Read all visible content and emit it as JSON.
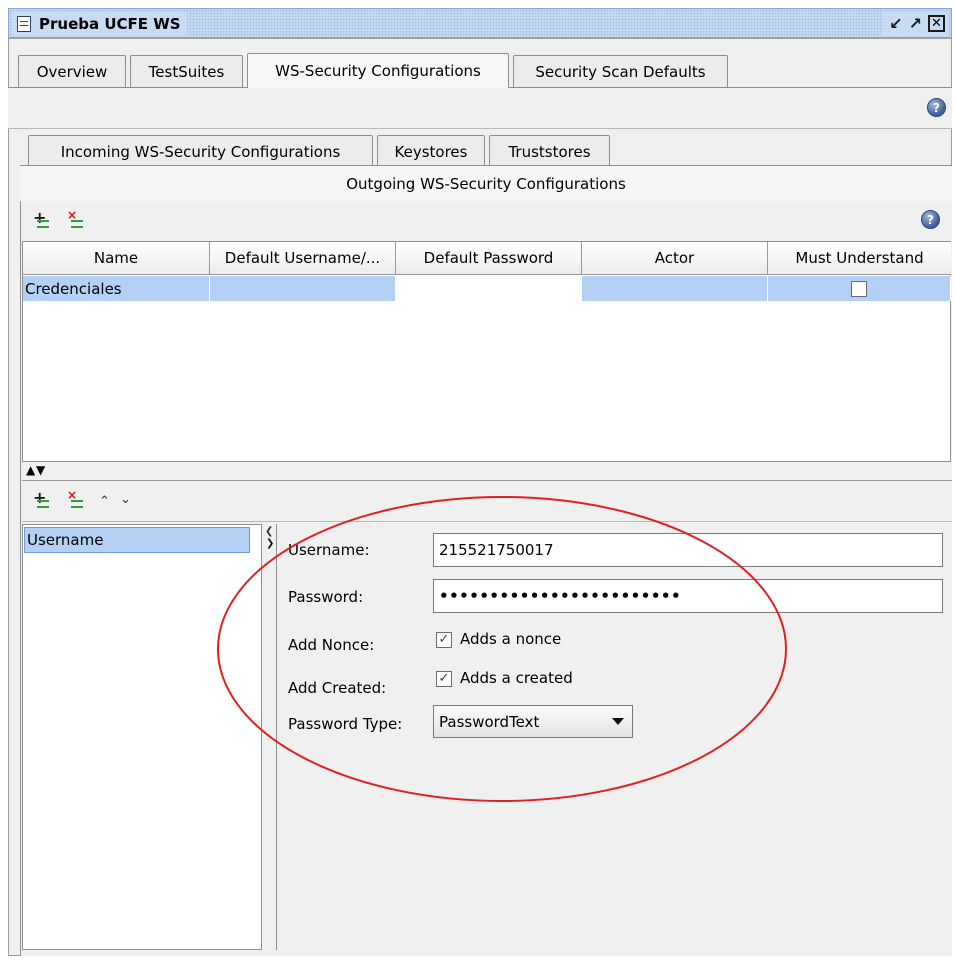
{
  "window": {
    "title": "Prueba UCFE WS",
    "buttons": [
      "restore-icon",
      "maximize-icon",
      "close-icon"
    ]
  },
  "main_tabs": [
    {
      "label": "Overview",
      "active": false
    },
    {
      "label": "TestSuites",
      "active": false
    },
    {
      "label": "WS-Security Configurations",
      "active": true
    },
    {
      "label": "Security Scan Defaults",
      "active": false
    }
  ],
  "sub_tabs": [
    {
      "label": "Incoming WS-Security Configurations",
      "active": false
    },
    {
      "label": "Keystores",
      "active": false
    },
    {
      "label": "Truststores",
      "active": false
    },
    {
      "label": "Outgoing WS-Security Configurations",
      "active": true
    }
  ],
  "help_icon_text": "?",
  "table": {
    "columns": [
      "Name",
      "Default Username/...",
      "Default Password",
      "Actor",
      "Must Understand"
    ],
    "rows": [
      {
        "name": "Credenciales",
        "default_username": "",
        "default_password": "",
        "actor": "",
        "must_understand": false
      }
    ]
  },
  "entries": {
    "items": [
      "Username"
    ]
  },
  "form": {
    "username_label": "Username:",
    "username_value": "215521750017",
    "password_label": "Password:",
    "password_value": "••••••••••••••••••••••••",
    "add_nonce_label": "Add Nonce:",
    "add_nonce_checked": true,
    "add_nonce_text": "Adds a nonce",
    "add_created_label": "Add Created:",
    "add_created_checked": true,
    "add_created_text": "Adds a created",
    "password_type_label": "Password Type:",
    "password_type_value": "PasswordText"
  },
  "colors": {
    "selection": "#b3d1f5",
    "highlight_ellipse": "#e02020",
    "title_bar": "#c7dbf3"
  }
}
